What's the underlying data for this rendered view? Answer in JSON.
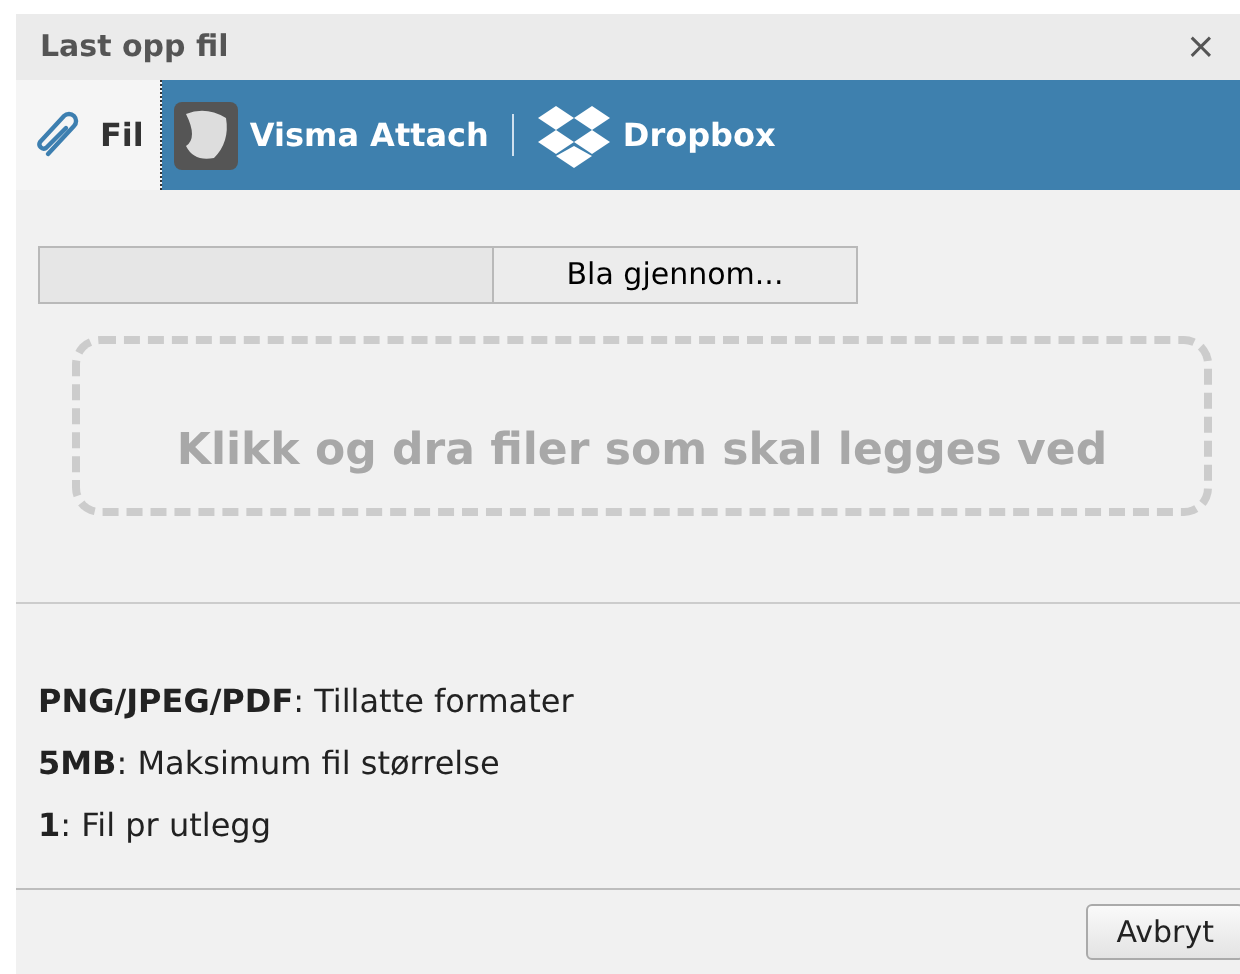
{
  "dialog": {
    "title": "Last opp fil",
    "close": "×"
  },
  "tabs": [
    {
      "label": "Fil",
      "kind": "paperclip",
      "selected": true
    },
    {
      "label": "Visma Attach",
      "kind": "attach",
      "selected": false
    },
    {
      "label": "Dropbox",
      "kind": "dropbox",
      "selected": false
    }
  ],
  "file_input": {
    "button": "Bla gjennom..."
  },
  "drop_zone": {
    "text": "Klikk og dra filer som skal legges ved"
  },
  "info_lines": [
    "**PNG/JPEG/PDF**: Tillatte formater",
    "**5MB**: Maksimum fil størrelse",
    "**1**: Fil pr utlegg"
  ],
  "buttons": [
    "Avbryt"
  ]
}
